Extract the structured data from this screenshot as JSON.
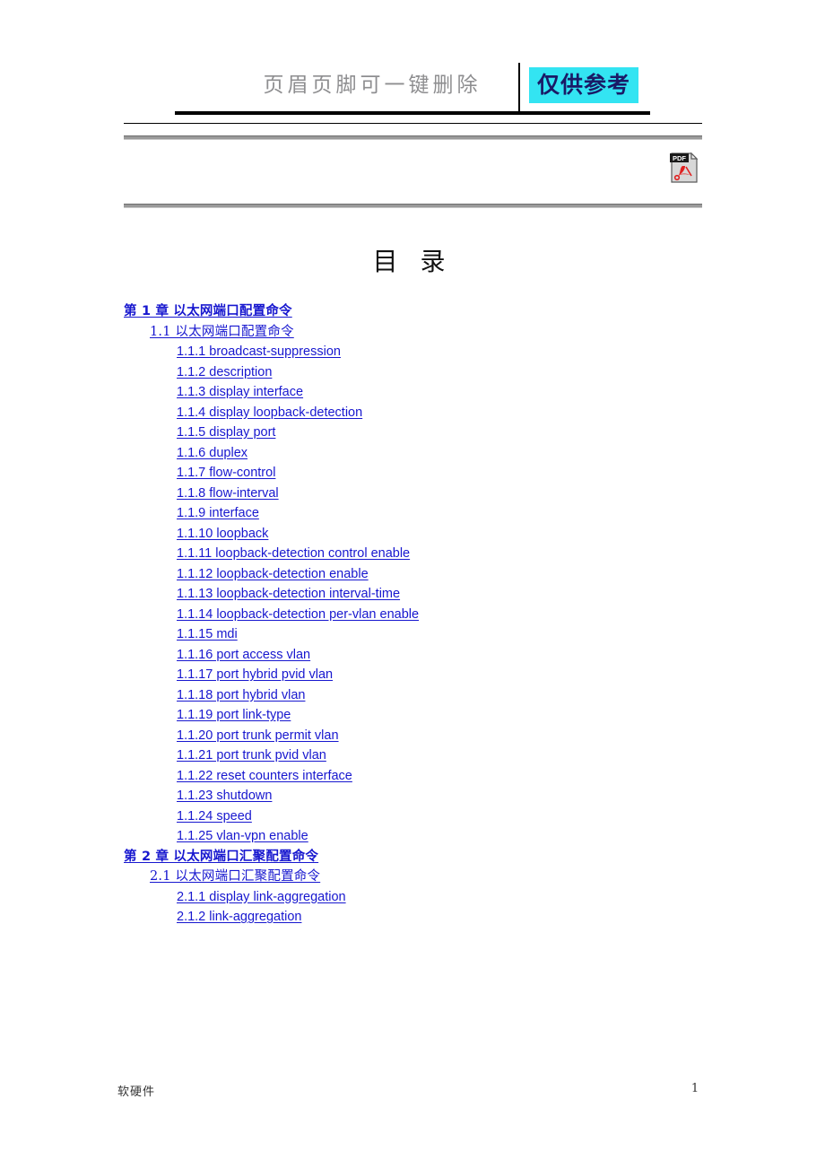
{
  "document": {
    "title": "目  录",
    "page_number": "1"
  },
  "header": {
    "watermark_text": "页眉页脚可一键删除",
    "badge_text": "仅供参考",
    "badge_bg_color": "#33e4f2",
    "badge_text_color": "#1a1a66",
    "watermark_color": "#8e8e90",
    "divider_color": "#000000",
    "pdf_icon_name": "pdf-file-icon"
  },
  "toc": {
    "entries": [
      {
        "level": "chapter",
        "label": "第 1 章  以太网端口配置命令"
      },
      {
        "level": "section",
        "label": "1.1  以太网端口配置命令"
      },
      {
        "level": "item",
        "label": "1.1.1 broadcast-suppression"
      },
      {
        "level": "item",
        "label": "1.1.2 description"
      },
      {
        "level": "item",
        "label": "1.1.3 display interface"
      },
      {
        "level": "item",
        "label": "1.1.4 display loopback-detection"
      },
      {
        "level": "item",
        "label": "1.1.5 display port"
      },
      {
        "level": "item",
        "label": "1.1.6 duplex"
      },
      {
        "level": "item",
        "label": "1.1.7 flow-control"
      },
      {
        "level": "item",
        "label": "1.1.8 flow-interval"
      },
      {
        "level": "item",
        "label": "1.1.9 interface"
      },
      {
        "level": "item",
        "label": "1.1.10 loopback"
      },
      {
        "level": "item",
        "label": "1.1.11 loopback-detection control enable"
      },
      {
        "level": "item",
        "label": "1.1.12 loopback-detection enable"
      },
      {
        "level": "item",
        "label": "1.1.13 loopback-detection interval-time"
      },
      {
        "level": "item",
        "label": "1.1.14 loopback-detection per-vlan enable"
      },
      {
        "level": "item",
        "label": "1.1.15 mdi"
      },
      {
        "level": "item",
        "label": "1.1.16 port access vlan"
      },
      {
        "level": "item",
        "label": "1.1.17 port hybrid pvid vlan"
      },
      {
        "level": "item",
        "label": "1.1.18 port hybrid vlan"
      },
      {
        "level": "item",
        "label": "1.1.19 port link-type"
      },
      {
        "level": "item",
        "label": "1.1.20 port trunk permit vlan"
      },
      {
        "level": "item",
        "label": "1.1.21 port trunk pvid vlan"
      },
      {
        "level": "item",
        "label": "1.1.22 reset counters interface"
      },
      {
        "level": "item",
        "label": "1.1.23 shutdown"
      },
      {
        "level": "item",
        "label": "1.1.24 speed"
      },
      {
        "level": "item",
        "label": "1.1.25 vlan-vpn enable"
      },
      {
        "level": "chapter",
        "label": "第 2 章  以太网端口汇聚配置命令"
      },
      {
        "level": "section",
        "label": "2.1  以太网端口汇聚配置命令"
      },
      {
        "level": "item",
        "label": "2.1.1 display link-aggregation"
      },
      {
        "level": "item",
        "label": "2.1.2 link-aggregation"
      }
    ],
    "link_color": "#1717cf"
  },
  "footer": {
    "left_text": "软硬件",
    "page_number": "1"
  }
}
